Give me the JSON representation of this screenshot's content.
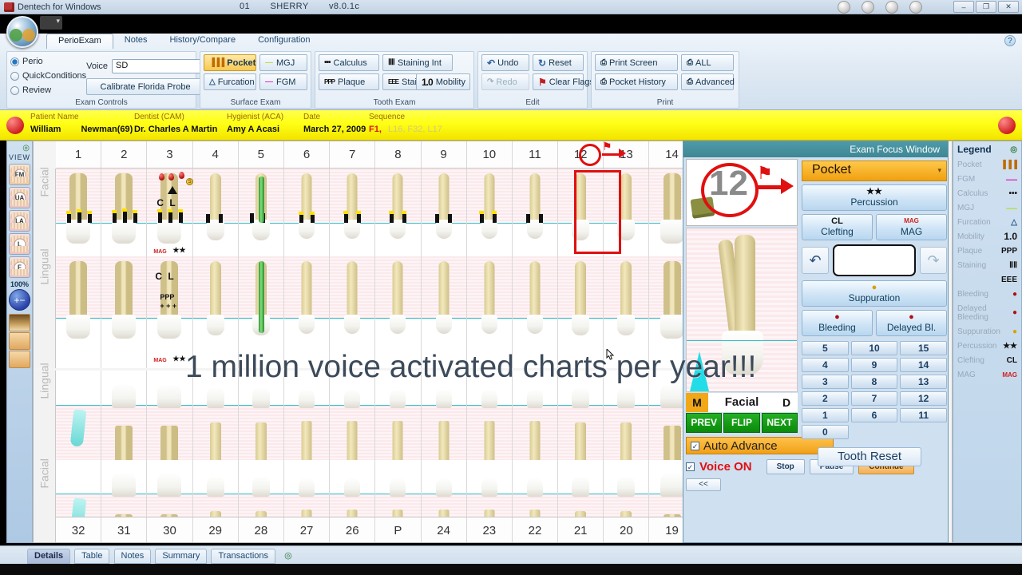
{
  "titlebar": {
    "app_title": "Dentech for Windows",
    "center_id": "01",
    "center_user": "SHERRY",
    "version": "v8.0.1c",
    "minimize": "–",
    "maximize": "❐",
    "close": "✕",
    "icons": [
      "clock-icon",
      "alarm-icon",
      "lightbulb-icon",
      "note-icon"
    ]
  },
  "ribbon": {
    "tabs": [
      {
        "label": "PerioExam",
        "active": true
      },
      {
        "label": "Notes",
        "active": false
      },
      {
        "label": "History/Compare",
        "active": false
      },
      {
        "label": "Configuration",
        "active": false
      }
    ],
    "help_label": "?",
    "groups": [
      {
        "title": "Exam Controls",
        "radios": [
          {
            "label": "Perio",
            "selected": true
          },
          {
            "label": "QuickConditions",
            "selected": false
          },
          {
            "label": "Review",
            "selected": false
          }
        ],
        "voice_label": "Voice",
        "voice_value": "SD",
        "calibrate_label": "Calibrate Florida Probe"
      },
      {
        "title": "Surface Exam",
        "buttons": [
          {
            "label": "Pocket",
            "icon": "▐▐▐",
            "state": "selected"
          },
          {
            "label": "MGJ",
            "icon": "—"
          },
          {
            "label": "Furcation",
            "icon": "△"
          },
          {
            "label": "FGM",
            "icon": "—"
          }
        ]
      },
      {
        "title": "Tooth Exam",
        "buttons": [
          {
            "label": "Calculus",
            "icon": "•••"
          },
          {
            "label": "Staining Int",
            "icon": "ⅡⅡ"
          },
          {
            "label": "Plaque",
            "icon": "PPP"
          },
          {
            "label": "Staining Ext",
            "icon": "EEE"
          },
          {
            "label": "Mobility",
            "icon": "1.0"
          }
        ]
      },
      {
        "title": "Edit",
        "buttons": [
          {
            "label": "Undo",
            "icon": "↶"
          },
          {
            "label": "Reset",
            "icon": "↻"
          },
          {
            "label": "Redo",
            "icon": "↷",
            "state": "disabled"
          },
          {
            "label": "Clear Flags",
            "icon": "⚑"
          }
        ]
      },
      {
        "title": "Print",
        "buttons": [
          {
            "label": "Print Screen",
            "icon": "⎙"
          },
          {
            "label": "ALL",
            "icon": "⎙"
          },
          {
            "label": "Pocket History",
            "icon": "⎙"
          },
          {
            "label": "Advanced",
            "icon": "⎙"
          }
        ]
      }
    ]
  },
  "patient": {
    "fields": [
      {
        "header": "Patient Name",
        "value": "William",
        "value2": "Newman(69)"
      },
      {
        "header": "Dentist (CAM)",
        "value": "Dr. Charles A Martin"
      },
      {
        "header": "Hygienist (ACA)",
        "value": "Amy A Acasi"
      },
      {
        "header": "Date",
        "value": "March 27, 2009"
      }
    ],
    "sequence_header": "Sequence",
    "sequence_active": "F1,",
    "sequence_rest": "L16,   F32,   L17"
  },
  "viewbar": {
    "title": "VIEW",
    "buttons": [
      {
        "label": "FM",
        "name": "view-full-mouth"
      },
      {
        "label": "UA",
        "name": "view-upper-arch"
      },
      {
        "label": "LA",
        "name": "view-lower-arch"
      },
      {
        "label": "L",
        "name": "view-lingual"
      },
      {
        "label": "F",
        "name": "view-facial"
      }
    ],
    "zoom_label": "100%",
    "zoom_icon": "+−"
  },
  "chart": {
    "upper_numbers": [
      "1",
      "2",
      "3",
      "4",
      "5",
      "6",
      "7",
      "8",
      "9",
      "10",
      "11",
      "12",
      "13",
      "14"
    ],
    "lower_numbers": [
      "32",
      "31",
      "30",
      "29",
      "28",
      "27",
      "26",
      "P",
      "24",
      "23",
      "22",
      "21",
      "20",
      "19"
    ],
    "row_labels": [
      "Facial",
      "Lingual",
      "Lingual",
      "Facial"
    ],
    "selected_tooth": "12",
    "annotations": {
      "tooth3_clefting": "C  L",
      "tooth3_plaque": "PPP",
      "tooth3_calculus": "+ + +",
      "tooth3_mag": "MAG",
      "tooth3_percussion": "★★"
    },
    "overlay_text": "1 million voice activated charts per year!!!"
  },
  "exam_focus": {
    "title": "Exam Focus Window",
    "tooth_number": "12",
    "mode_header": "Pocket",
    "buttons": [
      {
        "label": "Percussion",
        "symbol": "★★"
      },
      {
        "label": "Clefting",
        "symbol": "CL"
      },
      {
        "label": "MAG",
        "symbol": "MAG"
      },
      {
        "label": "Suppuration",
        "symbol": "●"
      },
      {
        "label": "Bleeding",
        "symbol": "●"
      },
      {
        "label": "Delayed Bl.",
        "symbol": "●"
      }
    ],
    "undo_icon": "↶",
    "redo_icon": "↷",
    "reading_value": "",
    "numpad": [
      [
        "5",
        "10",
        "15"
      ],
      [
        "4",
        "9",
        "14"
      ],
      [
        "3",
        "8",
        "13"
      ],
      [
        "2",
        "7",
        "12"
      ],
      [
        "1",
        "6",
        "11"
      ],
      [
        "0",
        "",
        ""
      ]
    ],
    "tooth_reset_label": "Tooth Reset",
    "surface_m": "M",
    "surface_name": "Facial",
    "surface_d": "D",
    "nav": [
      "PREV",
      "FLIP",
      "NEXT"
    ],
    "auto_advance_label": "Auto Advance",
    "auto_advance_checked": "✓",
    "voice_label": "Voice ON",
    "voice_checked": "✓",
    "voice_buttons": [
      "Stop",
      "Pause",
      "Continue"
    ],
    "collapse_label": "<<"
  },
  "legend": {
    "title": "Legend",
    "items": [
      {
        "label": "Pocket",
        "symbol": "▐▐▐",
        "color": "#c06a00"
      },
      {
        "label": "FGM",
        "symbol": "—",
        "color": "#e030c0"
      },
      {
        "label": "Calculus",
        "symbol": "•••",
        "color": "#111111"
      },
      {
        "label": "MGJ",
        "symbol": "—",
        "color": "#b8e04a"
      },
      {
        "label": "Furcation",
        "symbol": "△",
        "color": "#2a5a8a"
      },
      {
        "label": "Mobility",
        "symbol": "1.0",
        "color": "#111111"
      },
      {
        "label": "Plaque",
        "symbol": "PPP",
        "color": "#111111"
      },
      {
        "label": "Staining",
        "symbol": "ⅡⅡ",
        "color": "#111111"
      },
      {
        "label": "",
        "symbol": "EEE",
        "color": "#111111"
      },
      {
        "label": "Bleeding",
        "symbol": "●",
        "color": "#b01010"
      },
      {
        "label": "Delayed Bleeding",
        "symbol": "●",
        "color": "#b01010"
      },
      {
        "label": "Suppuration",
        "symbol": "●",
        "color": "#d8a000"
      },
      {
        "label": "Percussion",
        "symbol": "★★",
        "color": "#111111"
      },
      {
        "label": "Clefting",
        "symbol": "CL",
        "color": "#111111"
      },
      {
        "label": "MAG",
        "symbol": "MAG",
        "color": "#d02020"
      }
    ]
  },
  "bottom_tabs": [
    {
      "label": "Details",
      "active": true
    },
    {
      "label": "Table",
      "active": false
    },
    {
      "label": "Notes",
      "active": false
    },
    {
      "label": "Summary",
      "active": false
    },
    {
      "label": "Transactions",
      "active": false
    }
  ]
}
